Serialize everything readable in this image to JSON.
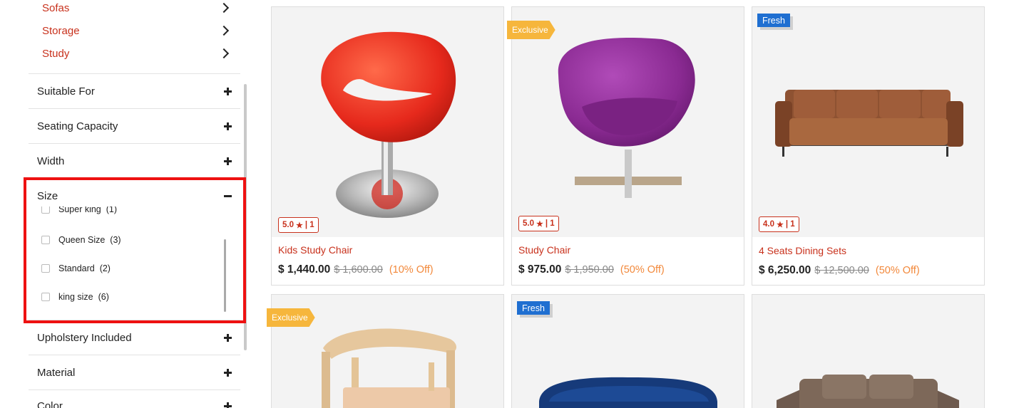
{
  "sidebar": {
    "categories": [
      {
        "label": "Sofas"
      },
      {
        "label": "Storage"
      },
      {
        "label": "Study"
      }
    ],
    "facets_top": [
      {
        "label": "Suitable For"
      },
      {
        "label": "Seating Capacity"
      },
      {
        "label": "Width"
      }
    ],
    "size_facet": {
      "label": "Size",
      "options": [
        {
          "label": "Super king",
          "count": "(1)"
        },
        {
          "label": "Queen Size",
          "count": "(3)"
        },
        {
          "label": "Standard",
          "count": "(2)"
        },
        {
          "label": "king size",
          "count": "(6)"
        }
      ]
    },
    "facets_bottom": [
      {
        "label": "Upholstery Included"
      },
      {
        "label": "Material"
      },
      {
        "label": "Color"
      }
    ]
  },
  "products": [
    {
      "name": "Kids Study Chair",
      "price": "$ 1,440.00",
      "mrp": "$ 1,600.00",
      "discount": "(10% Off)",
      "rating": "5.0",
      "reviews": "| 1",
      "tag": ""
    },
    {
      "name": "Study Chair",
      "price": "$ 975.00",
      "mrp": "$ 1,950.00",
      "discount": "(50% Off)",
      "rating": "5.0",
      "reviews": "| 1",
      "tag": "Exclusive"
    },
    {
      "name": "4 Seats Dining Sets",
      "price": "$ 6,250.00",
      "mrp": "$ 12,500.00",
      "discount": "(50% Off)",
      "rating": "4.0",
      "reviews": "| 1",
      "tag": "Fresh"
    },
    {
      "tag": "Exclusive"
    },
    {
      "tag": "Fresh"
    },
    {
      "tag": ""
    }
  ],
  "colors": {
    "accent": "#c8311c",
    "exclusive": "#f6b63c",
    "fresh": "#1f6fd1",
    "discount": "#f2883a",
    "highlight_box": "#ee1111"
  },
  "icons": [
    "chevron-right-icon",
    "plus-icon",
    "minus-icon",
    "star-icon",
    "checkbox-icon"
  ]
}
